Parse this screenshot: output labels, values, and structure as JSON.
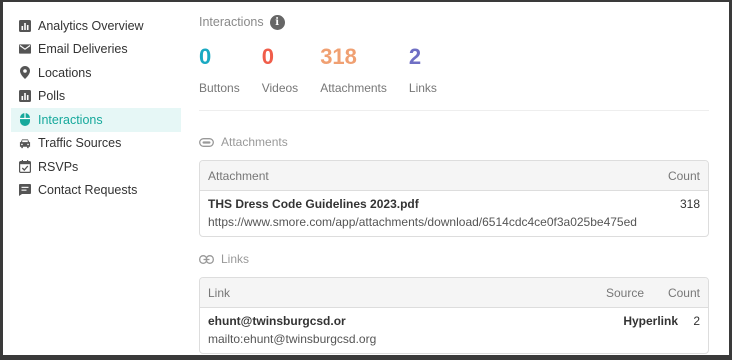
{
  "sidebar": {
    "items": [
      {
        "label": "Analytics Overview",
        "icon": "bar-chart-icon",
        "active": false
      },
      {
        "label": "Email Deliveries",
        "icon": "envelope-icon",
        "active": false
      },
      {
        "label": "Locations",
        "icon": "map-pin-icon",
        "active": false
      },
      {
        "label": "Polls",
        "icon": "bar-chart-icon",
        "active": false
      },
      {
        "label": "Interactions",
        "icon": "mouse-icon",
        "active": true
      },
      {
        "label": "Traffic Sources",
        "icon": "car-icon",
        "active": false
      },
      {
        "label": "RSVPs",
        "icon": "calendar-check-icon",
        "active": false
      },
      {
        "label": "Contact Requests",
        "icon": "message-icon",
        "active": false
      }
    ]
  },
  "interactions": {
    "title": "Interactions",
    "info_icon": "i",
    "stats": [
      {
        "value": "0",
        "label": "Buttons",
        "color": "#1aa9c2"
      },
      {
        "value": "0",
        "label": "Videos",
        "color": "#f05d4a"
      },
      {
        "value": "318",
        "label": "Attachments",
        "color": "#f0a072"
      },
      {
        "value": "2",
        "label": "Links",
        "color": "#6f6fc4"
      }
    ]
  },
  "attachments": {
    "title": "Attachments",
    "headers": {
      "name": "Attachment",
      "count": "Count"
    },
    "rows": [
      {
        "name": "THS Dress Code Guidelines 2023.pdf",
        "url": "https://www.smore.com/app/attachments/download/6514cdc4ce0f3a025be475ed",
        "count": "318"
      }
    ]
  },
  "links": {
    "title": "Links",
    "headers": {
      "name": "Link",
      "source": "Source",
      "count": "Count"
    },
    "rows": [
      {
        "name": "ehunt@twinsburgcsd.or",
        "url": "mailto:ehunt@twinsburgcsd.org",
        "source": "Hyperlink",
        "count": "2"
      }
    ]
  },
  "colors": {
    "accent": "#16a99c",
    "active_bg": "#e6f7f6"
  }
}
